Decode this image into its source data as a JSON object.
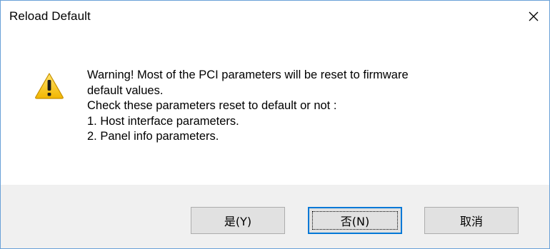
{
  "window": {
    "title": "Reload Default",
    "close_icon": "close-icon"
  },
  "message": {
    "icon": "warning-icon",
    "lines": [
      "Warning! Most of the PCI parameters will be reset to firmware",
      "default values.",
      "Check these parameters reset to default or not :",
      "1. Host interface parameters.",
      "2. Panel info parameters."
    ]
  },
  "buttons": {
    "yes": "是(Y)",
    "no": "否(N)",
    "cancel": "取消"
  },
  "colors": {
    "accent": "#0078d7",
    "window_border": "#6aa1d8",
    "footer_bg": "#f0f0f0",
    "warning_yellow": "#f5c400"
  }
}
